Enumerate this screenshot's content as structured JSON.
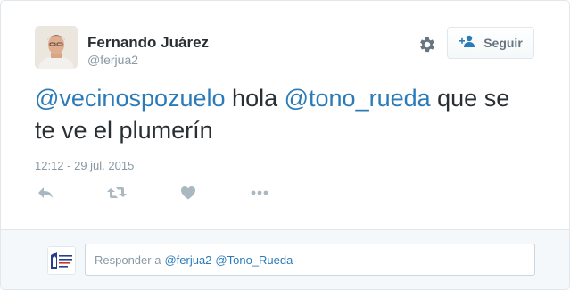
{
  "user": {
    "name": "Fernando Juárez",
    "handle": "@ferjua2"
  },
  "follow_button": {
    "label": "Seguir"
  },
  "tweet": {
    "mention_1": "@vecinospozuelo",
    "text_1": " hola ",
    "mention_2": "@tono_rueda",
    "text_2": " que se te ve el plumerín",
    "timestamp": "12:12 - 29 jul. 2015"
  },
  "actions": {
    "icons": [
      "reply-icon",
      "retweet-icon",
      "like-icon",
      "more-icon"
    ]
  },
  "reply": {
    "prefix": "Responder a",
    "mention_1": "@ferjua2",
    "mention_2": "@Tono_Rueda"
  },
  "colors": {
    "link": "#2b7bb9",
    "text": "#292f33",
    "muted": "#8899a6",
    "icon": "#aab8c2",
    "reply_bg": "#f5f8fa",
    "logo": "#2a3d8f"
  }
}
